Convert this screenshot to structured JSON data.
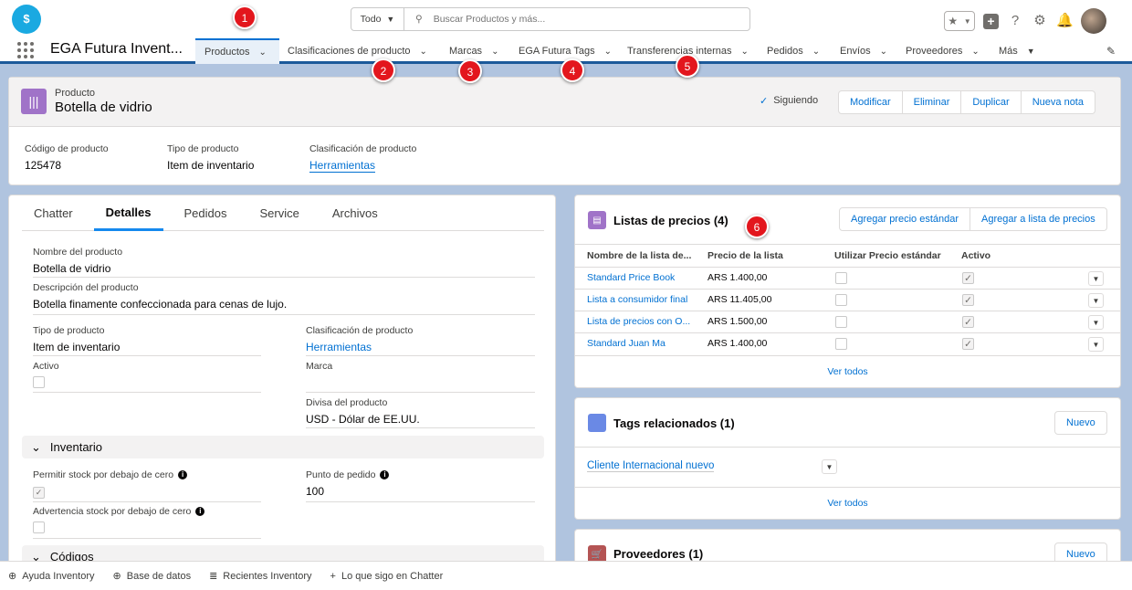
{
  "header": {
    "logo_glyph": "$",
    "search": {
      "scope": "Todo",
      "placeholder": "Buscar Productos y más..."
    }
  },
  "nav": {
    "app_name": "EGA Futura Invent...",
    "items": [
      {
        "label": "Productos"
      },
      {
        "label": "Clasificaciones de producto"
      },
      {
        "label": "Marcas"
      },
      {
        "label": "EGA Futura Tags"
      },
      {
        "label": "Transferencias internas"
      },
      {
        "label": "Pedidos"
      },
      {
        "label": "Envíos"
      },
      {
        "label": "Proveedores"
      },
      {
        "label": "Más"
      }
    ]
  },
  "callouts": [
    "1",
    "2",
    "3",
    "4",
    "5",
    "6"
  ],
  "record": {
    "type": "Producto",
    "name": "Botella de vidrio",
    "following": "Siguiendo",
    "actions": [
      "Modificar",
      "Eliminar",
      "Duplicar",
      "Nueva nota"
    ],
    "highlights": [
      {
        "label": "Código de producto",
        "value": "125478"
      },
      {
        "label": "Tipo de producto",
        "value": "Item de inventario"
      },
      {
        "label": "Clasificación de producto",
        "value": "Herramientas"
      }
    ]
  },
  "tabs": [
    "Chatter",
    "Detalles",
    "Pedidos",
    "Service",
    "Archivos"
  ],
  "details": {
    "product_name": {
      "label": "Nombre del producto",
      "value": "Botella de vidrio"
    },
    "description": {
      "label": "Descripción del producto",
      "value": "Botella finamente confeccionada para cenas de lujo."
    },
    "product_type": {
      "label": "Tipo de producto",
      "value": "Item de inventario"
    },
    "classification": {
      "label": "Clasificación de producto",
      "value": "Herramientas"
    },
    "active": {
      "label": "Activo",
      "checked": false
    },
    "brand": {
      "label": "Marca",
      "value": ""
    },
    "currency": {
      "label": "Divisa del producto",
      "value": "USD - Dólar de EE.UU."
    },
    "inventory_section": "Inventario",
    "allow_negative": {
      "label": "Permitir stock por debajo de cero",
      "checked": true
    },
    "reorder_point": {
      "label": "Punto de pedido",
      "value": "100"
    },
    "negative_warning": {
      "label": "Advertencia stock por debajo de cero",
      "checked": false
    },
    "codes_section": "Códigos"
  },
  "price_lists": {
    "title": "Listas de precios (4)",
    "actions": [
      "Agregar precio estándar",
      "Agregar a lista de precios"
    ],
    "columns": [
      "Nombre de la lista de...",
      "Precio de la lista",
      "Utilizar Precio estándar",
      "Activo"
    ],
    "rows": [
      {
        "name": "Standard Price Book",
        "price": "ARS 1.400,00",
        "use_standard": false,
        "active": true
      },
      {
        "name": "Lista a consumidor final",
        "price": "ARS 11.405,00",
        "use_standard": false,
        "active": true
      },
      {
        "name": "Lista de precios con O...",
        "price": "ARS 1.500,00",
        "use_standard": false,
        "active": true
      },
      {
        "name": "Standard Juan Ma",
        "price": "ARS 1.400,00",
        "use_standard": false,
        "active": true
      }
    ],
    "view_all": "Ver todos"
  },
  "tags": {
    "title": "Tags relacionados (1)",
    "new_label": "Nuevo",
    "items": [
      "Cliente Internacional nuevo"
    ],
    "view_all": "Ver todos"
  },
  "suppliers": {
    "title": "Proveedores (1)",
    "new_label": "Nuevo"
  },
  "utility_bar": [
    "Ayuda Inventory",
    "Base de datos",
    "Recientes Inventory",
    "Lo que sigo en Chatter"
  ],
  "colors": {
    "brand": "#0070d2",
    "nav_accent": "#1b5a9a",
    "callout": "#e3161d",
    "product_icon": "#a073c8",
    "price_icon": "#a073c8",
    "tag_icon": "#6a89e5",
    "supplier_icon": "#b45454"
  }
}
